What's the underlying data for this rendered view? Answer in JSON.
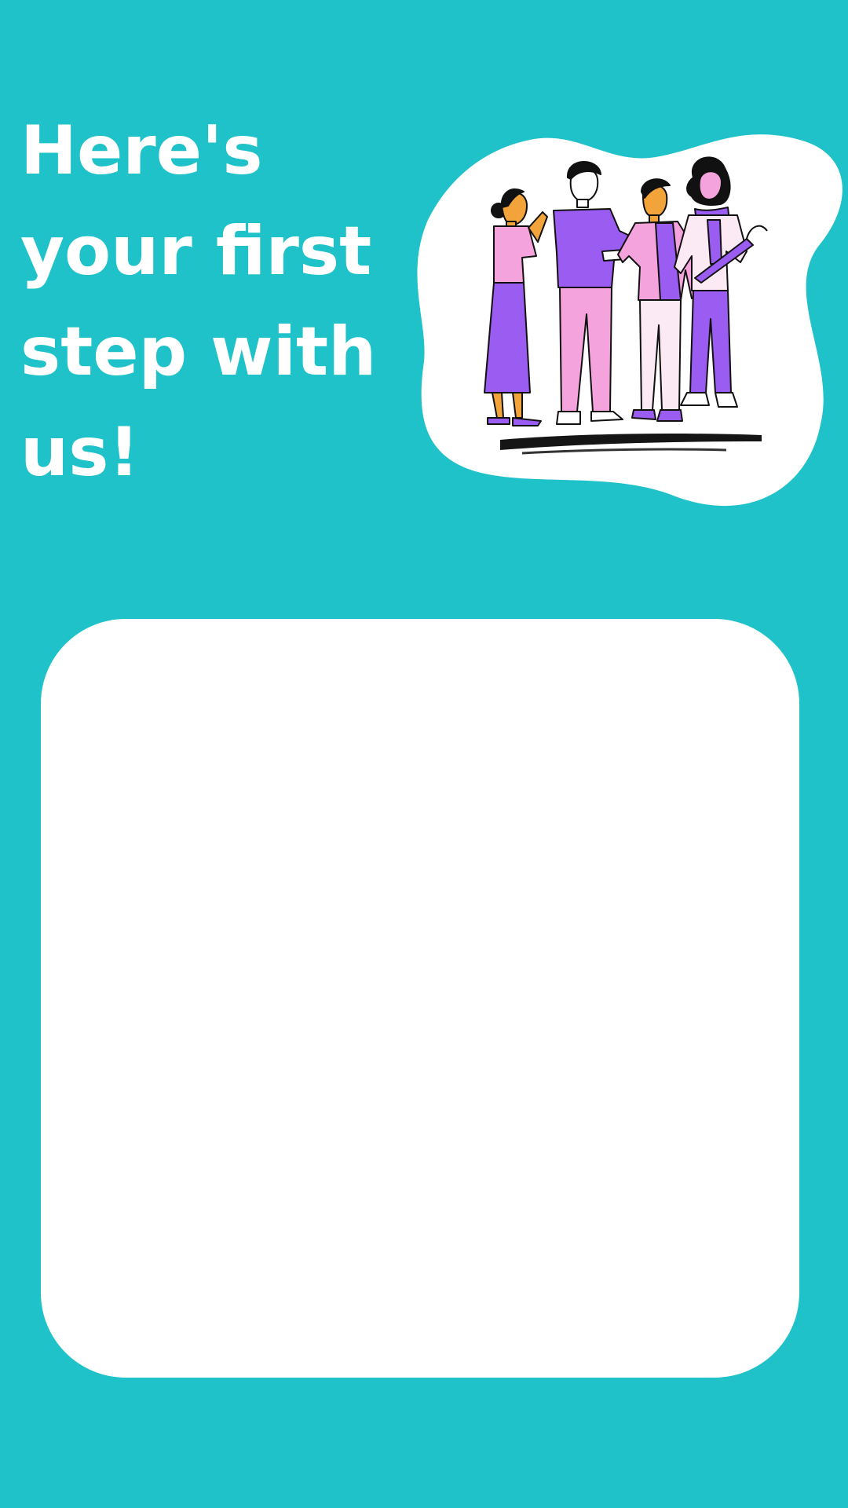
{
  "headline": {
    "lines": [
      "Here's",
      "your first",
      "step with",
      "us!"
    ]
  },
  "illustration": {
    "icon": "people-greeting-handshake-illustration"
  },
  "card": {
    "content": ""
  },
  "colors": {
    "background": "#1fc2c9",
    "headline_text": "#ffffff",
    "card": "#ffffff",
    "purple": "#9b5cf2",
    "pink": "#f5a3dc",
    "skin": "#f2a33a",
    "outline": "#111111"
  }
}
